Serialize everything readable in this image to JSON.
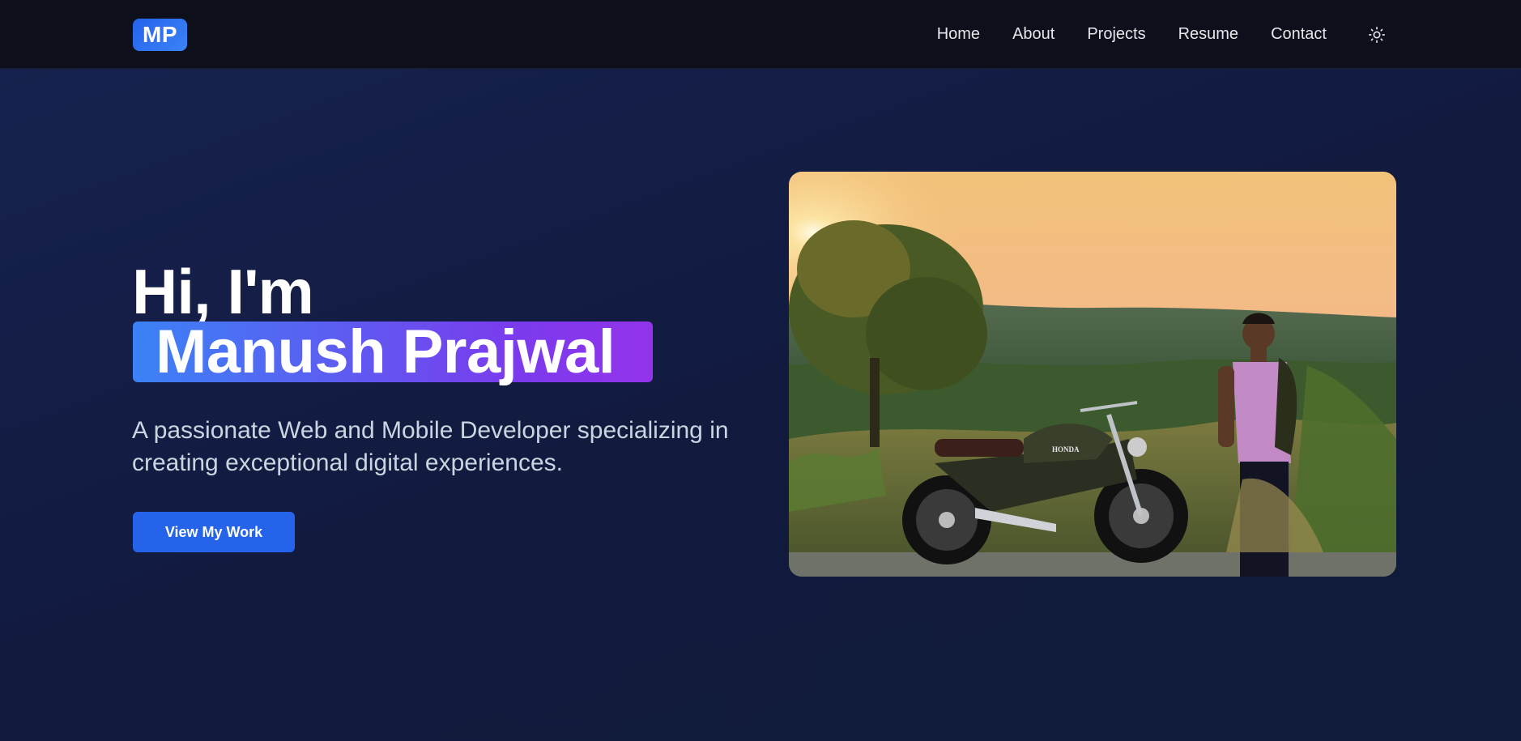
{
  "nav": {
    "logo_text": "MP",
    "links": [
      {
        "label": "Home"
      },
      {
        "label": "About"
      },
      {
        "label": "Projects"
      },
      {
        "label": "Resume"
      },
      {
        "label": "Contact"
      }
    ],
    "theme_icon": "sun-icon"
  },
  "hero": {
    "greeting": "Hi, I'm",
    "name": "Manush Prajwal",
    "description": "A passionate Web and Mobile Developer specializing in creating exceptional digital experiences.",
    "cta_label": "View My Work",
    "photo_motorcycle_badge": "HONDA"
  },
  "colors": {
    "nav_bg": "#0d0f1a",
    "hero_bg": "#131d44",
    "accent": "#2563eb",
    "gradient_start": "#3b82f6",
    "gradient_end": "#9333ea",
    "text_primary": "#ffffff",
    "text_muted": "#cbd5e1"
  }
}
